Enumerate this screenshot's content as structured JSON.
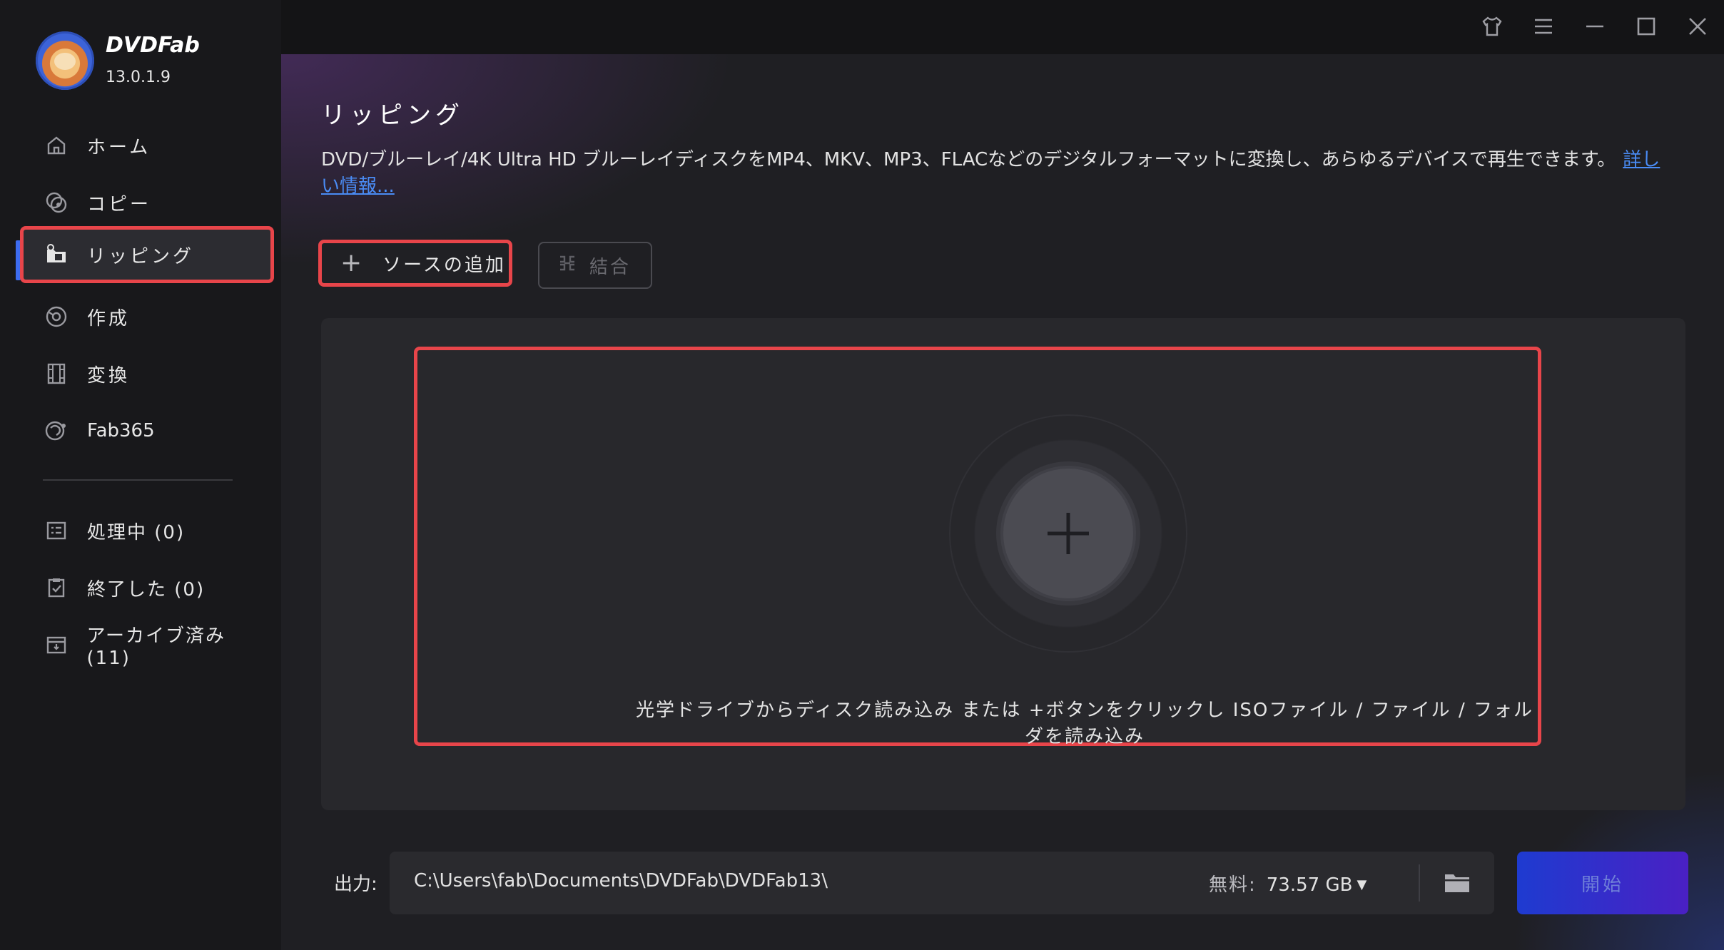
{
  "app": {
    "brand": "DVDFab",
    "version": "13.0.1.9"
  },
  "window_controls": [
    "shirt-icon",
    "menu-icon",
    "minimize-icon",
    "maximize-icon",
    "close-icon"
  ],
  "sidebar": {
    "items": [
      {
        "label": "ホーム",
        "icon": "home-icon"
      },
      {
        "label": "コピー",
        "icon": "copy-disc-icon"
      },
      {
        "label": "リッピング",
        "icon": "ripper-icon",
        "active": true
      },
      {
        "label": "作成",
        "icon": "creator-icon"
      },
      {
        "label": "変換",
        "icon": "film-icon"
      },
      {
        "label": "Fab365",
        "icon": "fab365-icon"
      }
    ],
    "tasks": [
      {
        "label": "処理中 (0)",
        "icon": "processing-list-icon"
      },
      {
        "label": "終了した (0)",
        "icon": "clipboard-check-icon"
      },
      {
        "label": "アーカイブ済み (11)",
        "icon": "archive-box-icon"
      }
    ]
  },
  "main": {
    "title": "リッピング",
    "description": "DVD/ブルーレイ/4K Ultra HD ブルーレイディスクをMP4、MKV、MP3、FLACなどのデジタルフォーマットに変換し、あらゆるデバイスで再生できます。",
    "more_link": "詳しい情報...",
    "add_source_label": "ソースの追加",
    "merge_label": "結合",
    "drop_hint": "光学ドライブからディスク読み込み または +ボタンをクリックし ISOファイル / ファイル / フォルダを読み込み"
  },
  "output": {
    "label": "出力:",
    "path": "C:\\Users\\fab\\Documents\\DVDFab\\DVDFab13\\",
    "free_label": "無料:",
    "free_value": "73.57 GB",
    "start_label": "開始"
  },
  "colors": {
    "highlight": "#e8454a",
    "accent_blue": "#3d6cf0",
    "start_gradient_from": "#1e3bd0",
    "start_gradient_to": "#4a20c4"
  }
}
